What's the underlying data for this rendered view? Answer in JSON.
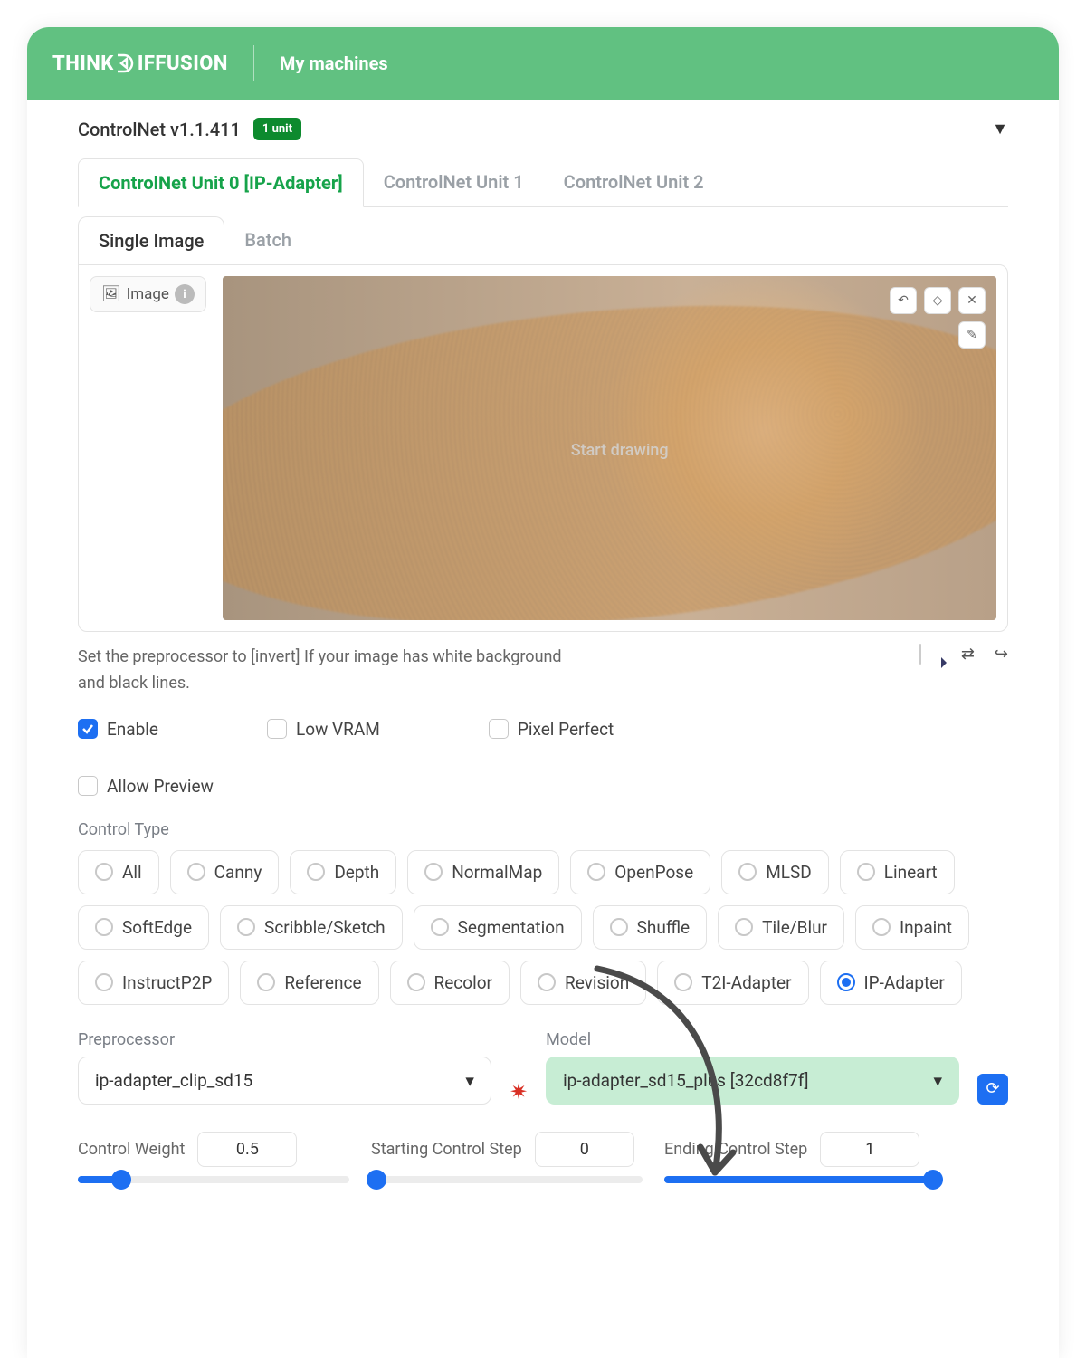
{
  "topbar": {
    "brand": "THINKDIFFUSION",
    "nav_my_machines": "My machines"
  },
  "section": {
    "title": "ControlNet v1.1.411",
    "badge": "1 unit"
  },
  "tabs": {
    "unit0": "ControlNet Unit 0 [IP-Adapter]",
    "unit1": "ControlNet Unit 1",
    "unit2": "ControlNet Unit 2"
  },
  "subtabs": {
    "single": "Single Image",
    "batch": "Batch"
  },
  "image": {
    "tab_label": "Image",
    "start_drawing": "Start drawing"
  },
  "hint": "Set the preprocessor to [invert] If your image has white background and black lines.",
  "checks": {
    "enable": "Enable",
    "low_vram": "Low VRAM",
    "pixel_perfect": "Pixel Perfect",
    "allow_preview": "Allow Preview"
  },
  "control_type_label": "Control Type",
  "control_types": {
    "all": "All",
    "canny": "Canny",
    "depth": "Depth",
    "normalmap": "NormalMap",
    "openpose": "OpenPose",
    "mlsd": "MLSD",
    "lineart": "Lineart",
    "softedge": "SoftEdge",
    "scribble": "Scribble/Sketch",
    "segmentation": "Segmentation",
    "shuffle": "Shuffle",
    "tileblur": "Tile/Blur",
    "inpaint": "Inpaint",
    "instructp2p": "InstructP2P",
    "reference": "Reference",
    "recolor": "Recolor",
    "revision": "Revision",
    "t2i": "T2I-Adapter",
    "ipadapter": "IP-Adapter"
  },
  "preproc": {
    "label": "Preprocessor",
    "value": "ip-adapter_clip_sd15"
  },
  "model": {
    "label": "Model",
    "value": "ip-adapter_sd15_plus [32cd8f7f]"
  },
  "sliders": {
    "weight": {
      "label": "Control Weight",
      "value": "0.5",
      "pct": 16
    },
    "start": {
      "label": "Starting Control Step",
      "value": "0",
      "pct": 2
    },
    "end": {
      "label": "Ending Control Step",
      "value": "1",
      "pct": 99
    }
  }
}
